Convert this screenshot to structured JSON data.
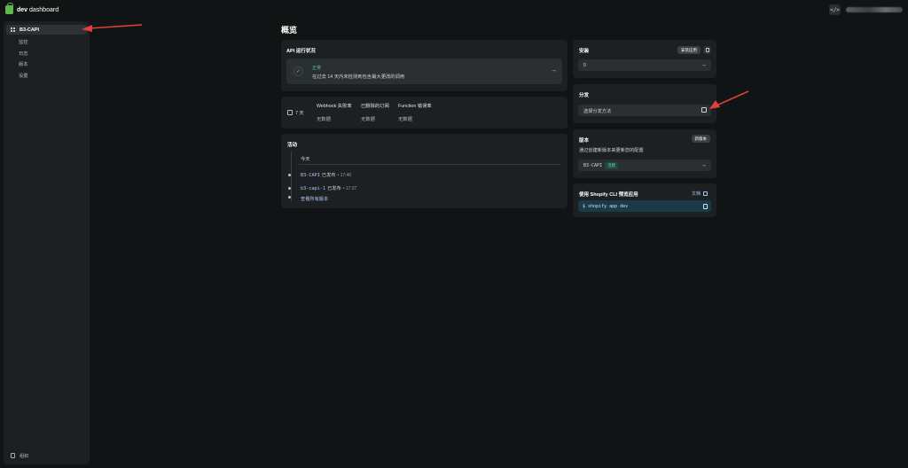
{
  "topbar": {
    "brand_bold": "dev",
    "brand_rest": " dashboard",
    "code_icon": "code-icon"
  },
  "sidebar": {
    "app_name": "B3-CAPI",
    "items": [
      {
        "label": "监控"
      },
      {
        "label": "日志"
      },
      {
        "label": "版本"
      },
      {
        "label": "设置"
      }
    ],
    "footer_label": "组织"
  },
  "main": {
    "title": "概览",
    "api_status": {
      "title": "API 运行状况",
      "badge": "正常",
      "description": "在过去 14 天内未检测到包含最大更改的调用"
    },
    "metrics": {
      "period": "7 天",
      "columns": [
        {
          "header": "Webhook 失败率",
          "value": "无数据"
        },
        {
          "header": "已删除的订阅",
          "value": "无数据"
        },
        {
          "header": "Function 错误率",
          "value": "无数据"
        }
      ]
    },
    "activity": {
      "title": "活动",
      "day": "今天",
      "events": [
        {
          "name": "B3-CAPI",
          "text": "已发布",
          "time": "• 17:46"
        },
        {
          "name": "b3-capi-1",
          "text": "已发布",
          "time": "• 17:37"
        }
      ],
      "view_all": "查看所有版本"
    }
  },
  "right": {
    "install": {
      "title": "安装",
      "button": "安装应用",
      "count": "0"
    },
    "distribution": {
      "title": "分发",
      "choose": "选择分发方法"
    },
    "versions": {
      "title": "版本",
      "button": "新版本",
      "description": "通过创建新版本来更新您的配置",
      "current": "B3-CAPI",
      "status": "活跃"
    },
    "cli": {
      "title": "使用 Shopify CLI 预览应用",
      "docs": "文档",
      "command": "$ shopify app dev"
    }
  },
  "colors": {
    "background": "#111415",
    "card": "#1c2022",
    "accent_green": "#58c2a0",
    "link_blue": "#a9c9f5",
    "annotation_red": "#e0403a"
  }
}
